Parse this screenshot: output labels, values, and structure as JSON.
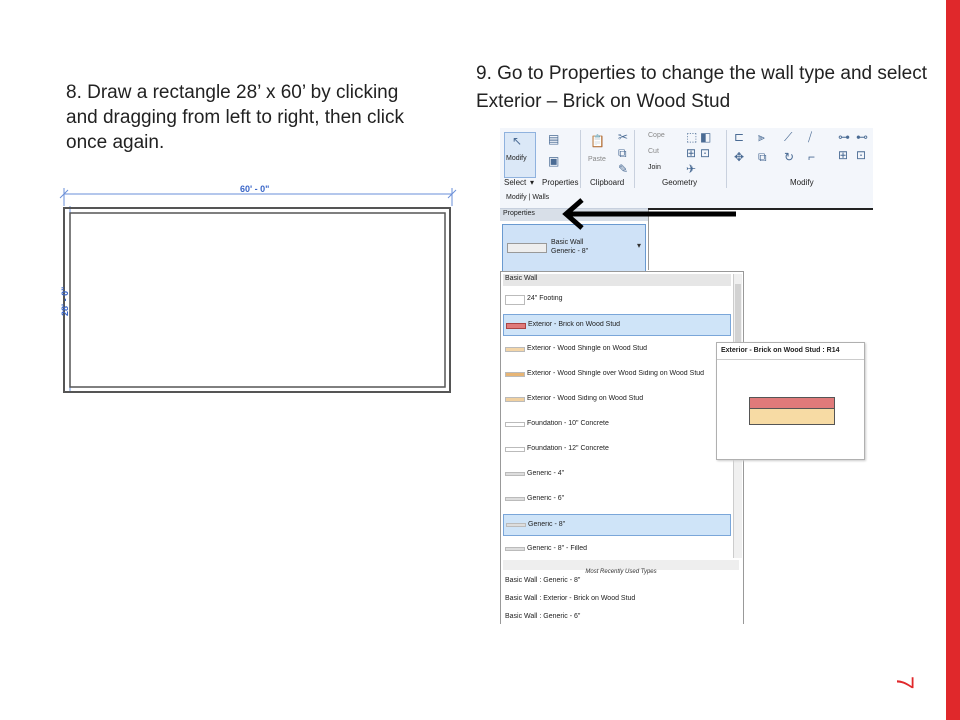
{
  "slide": {
    "step8": "8. Draw a rectangle 28’ x 60’ by clicking and dragging from left to right, then click once again.",
    "step9": "9. Go to Properties to change the wall type and select Exterior – Brick on Wood Stud",
    "slide_number": "7",
    "accent_color": "#e0282b"
  },
  "drawing": {
    "dim_horizontal": "60' - 0\"",
    "dim_vertical": "28' - 0\"",
    "dim_color": "#3a66c8"
  },
  "ribbon": {
    "groups": [
      "Select",
      "Properties",
      "Clipboard",
      "Geometry",
      "Modify"
    ],
    "select_arrow": "▾",
    "modify_label": "Modify",
    "paste_label": "Paste",
    "cope_label": "Cope",
    "cut_label": "Cut",
    "join_label": "Join",
    "context_tab": "Modify | Walls"
  },
  "properties": {
    "header": "Properties",
    "family": "Basic Wall",
    "type": "Generic - 8\""
  },
  "dropdown": {
    "group": "Basic Wall",
    "items": [
      "24\" Footing",
      "Exterior - Brick on Wood Stud",
      "Exterior - Wood Shingle on Wood Stud",
      "Exterior - Wood Shingle over Wood Siding on Wood Stud",
      "Exterior - Wood Siding on Wood Stud",
      "Foundation - 10\" Concrete",
      "Foundation - 12\" Concrete",
      "Generic - 4\"",
      "Generic - 6\"",
      "Generic - 8\"",
      "Generic - 8\" - Filled"
    ],
    "mru_header": "Most Recently Used Types",
    "mru_items": [
      "Basic Wall : Generic - 8\"",
      "Basic Wall : Exterior - Brick on Wood Stud",
      "Basic Wall : Generic - 6\""
    ]
  },
  "tooltip": {
    "title": "Exterior - Brick on Wood Stud : R14"
  },
  "icons": [
    "modify-arrow-icon",
    "paste-icon",
    "cut-icon",
    "join-icon",
    "move-icon",
    "rotate-icon",
    "pointer-arrow-icon"
  ]
}
